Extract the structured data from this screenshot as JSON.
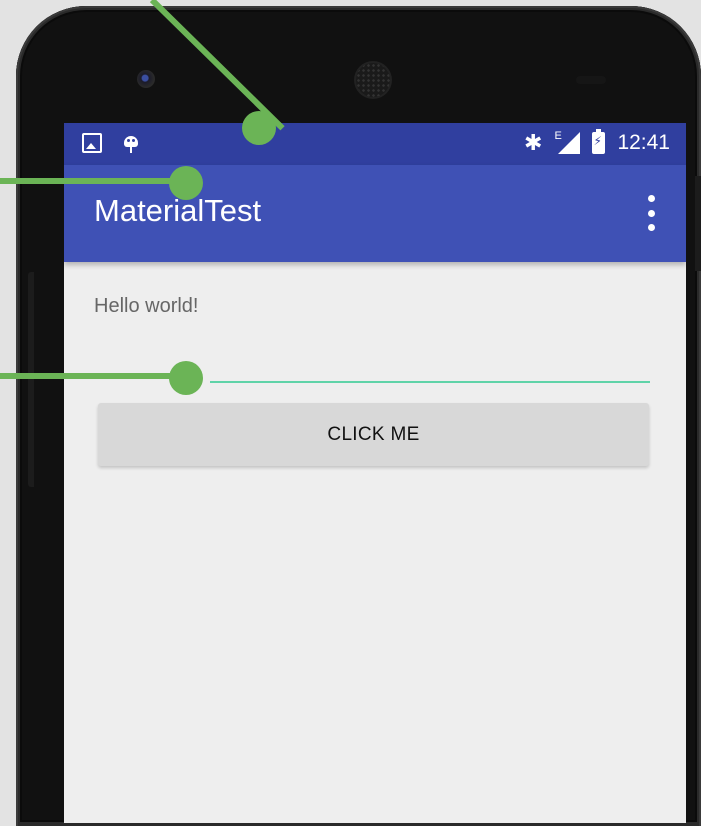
{
  "status_bar": {
    "time": "12:41",
    "signal_label": "E",
    "left_icons": [
      "image-icon",
      "android-debug-icon"
    ],
    "right_icons": [
      "bluetooth-icon",
      "cell-signal-icon",
      "battery-charging-icon"
    ]
  },
  "toolbar": {
    "title": "MaterialTest",
    "overflow_icon": "more-vert-icon"
  },
  "content": {
    "hello_text": "Hello world!",
    "edit_text_value": "",
    "button_label": "CLICK ME"
  },
  "colors": {
    "status_bar": "#303f9f",
    "app_bar": "#3f51b5",
    "accent_underline": "#5fd3a8",
    "callout": "#6bb456",
    "background": "#eeeeee",
    "button": "#d8d8d8"
  }
}
